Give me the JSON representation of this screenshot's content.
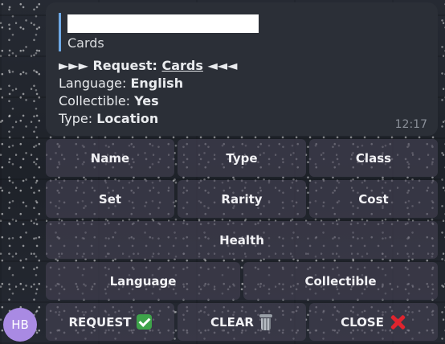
{
  "message": {
    "reply_preview": {
      "text": "Cards"
    },
    "request_line": {
      "prefix": "►►► Request: ",
      "link": "Cards",
      "suffix": " ◄◄◄"
    },
    "fields": [
      {
        "label": "Language: ",
        "value": "English"
      },
      {
        "label": "Collectible: ",
        "value": "Yes"
      },
      {
        "label": "Type: ",
        "value": "Location"
      }
    ],
    "time": "12:17"
  },
  "keyboard": {
    "rows": [
      [
        "Name",
        "Type",
        "Class"
      ],
      [
        "Set",
        "Rarity",
        "Cost"
      ],
      [
        "Health"
      ],
      [
        "Language",
        "Collectible"
      ],
      [
        "REQUEST",
        "CLEAR",
        "CLOSE"
      ]
    ],
    "icons": {
      "request": "check-mark-emoji",
      "clear": "wastebasket-emoji",
      "close": "cross-mark-emoji"
    }
  },
  "avatar": {
    "initials": "HB",
    "color": "#a98ae3"
  },
  "colors": {
    "bubble": "#2b2f37",
    "reply_accent": "#6ea9e6",
    "button": "#46425499"
  }
}
